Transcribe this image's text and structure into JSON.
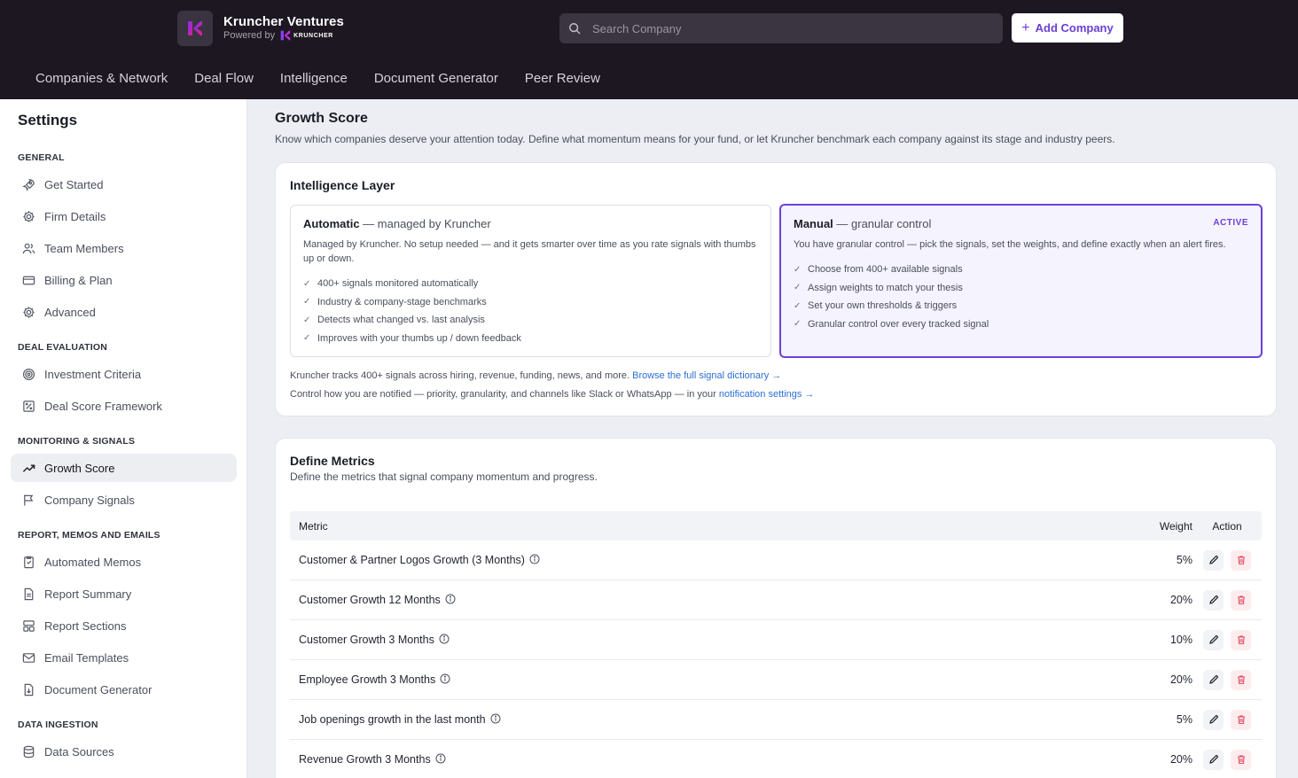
{
  "header": {
    "brand_name": "Kruncher Ventures",
    "powered_by": "Powered by",
    "powered_logo_text": "KRUNCHER",
    "search_placeholder": "Search Company",
    "add_company_label": "Add Company",
    "nav": [
      "Companies & Network",
      "Deal Flow",
      "Intelligence",
      "Document Generator",
      "Peer Review"
    ]
  },
  "sidebar": {
    "title": "Settings",
    "sections": [
      {
        "label": "GENERAL",
        "items": [
          {
            "label": "Get Started",
            "icon": "rocket-icon"
          },
          {
            "label": "Firm Details",
            "icon": "gear-icon"
          },
          {
            "label": "Team Members",
            "icon": "users-icon"
          },
          {
            "label": "Billing & Plan",
            "icon": "credit-card-icon"
          },
          {
            "label": "Advanced",
            "icon": "gear-icon"
          }
        ]
      },
      {
        "label": "DEAL EVALUATION",
        "items": [
          {
            "label": "Investment Criteria",
            "icon": "target-icon"
          },
          {
            "label": "Deal Score Framework",
            "icon": "percent-icon"
          }
        ]
      },
      {
        "label": "MONITORING & SIGNALS",
        "items": [
          {
            "label": "Growth Score",
            "icon": "trending-up-icon",
            "active": true
          },
          {
            "label": "Company Signals",
            "icon": "flag-icon"
          }
        ]
      },
      {
        "label": "REPORT, MEMOS AND EMAILS",
        "items": [
          {
            "label": "Automated Memos",
            "icon": "memo-icon"
          },
          {
            "label": "Report Summary",
            "icon": "document-icon"
          },
          {
            "label": "Report Sections",
            "icon": "layout-icon"
          },
          {
            "label": "Email Templates",
            "icon": "mail-icon"
          },
          {
            "label": "Document Generator",
            "icon": "file-download-icon"
          }
        ]
      },
      {
        "label": "DATA INGESTION",
        "items": [
          {
            "label": "Data Sources",
            "icon": "database-icon"
          }
        ]
      }
    ]
  },
  "page": {
    "title": "Growth Score",
    "description": "Know which companies deserve your attention today. Define what momentum means for your fund, or let Kruncher benchmark each company against its stage and industry peers."
  },
  "intelligence": {
    "title": "Intelligence Layer",
    "automatic": {
      "name": "Automatic",
      "suffix": " — managed by Kruncher",
      "description": "Managed by Kruncher. No setup needed — and it gets smarter over time as you rate signals with thumbs up or down.",
      "features": [
        "400+ signals monitored automatically",
        "Industry & company-stage benchmarks",
        "Detects what changed vs. last analysis",
        "Improves with your thumbs up / down feedback"
      ]
    },
    "manual": {
      "name": "Manual",
      "suffix": " — granular control",
      "badge": "ACTIVE",
      "description": "You have granular control — pick the signals, set the weights, and define exactly when an alert fires.",
      "features": [
        "Choose from 400+ available signals",
        "Assign weights to match your thesis",
        "Set your own thresholds & triggers",
        "Granular control over every tracked signal"
      ]
    },
    "note1_text": "Kruncher tracks 400+ signals across hiring, revenue, funding, news, and more. ",
    "note1_link": "Browse the full signal dictionary →",
    "note2_text": "Control how you are notified — priority, granularity, and channels like Slack or WhatsApp — in your ",
    "note2_link": "notification settings →"
  },
  "metrics": {
    "title": "Define Metrics",
    "description": "Define the metrics that signal company momentum and progress.",
    "columns": {
      "metric": "Metric",
      "weight": "Weight",
      "action": "Action"
    },
    "rows": [
      {
        "metric": "Customer & Partner Logos Growth (3 Months)",
        "weight": "5%"
      },
      {
        "metric": "Customer Growth 12 Months",
        "weight": "20%"
      },
      {
        "metric": "Customer Growth 3 Months",
        "weight": "10%"
      },
      {
        "metric": "Employee Growth 3 Months",
        "weight": "20%"
      },
      {
        "metric": "Job openings growth in the last month",
        "weight": "5%"
      },
      {
        "metric": "Revenue Growth 3 Months",
        "weight": "20%"
      }
    ]
  },
  "colors": {
    "accent": "#6d40d9",
    "header_bg": "#1d1722",
    "link": "#2a6fd6",
    "delete": "#e0506a"
  }
}
